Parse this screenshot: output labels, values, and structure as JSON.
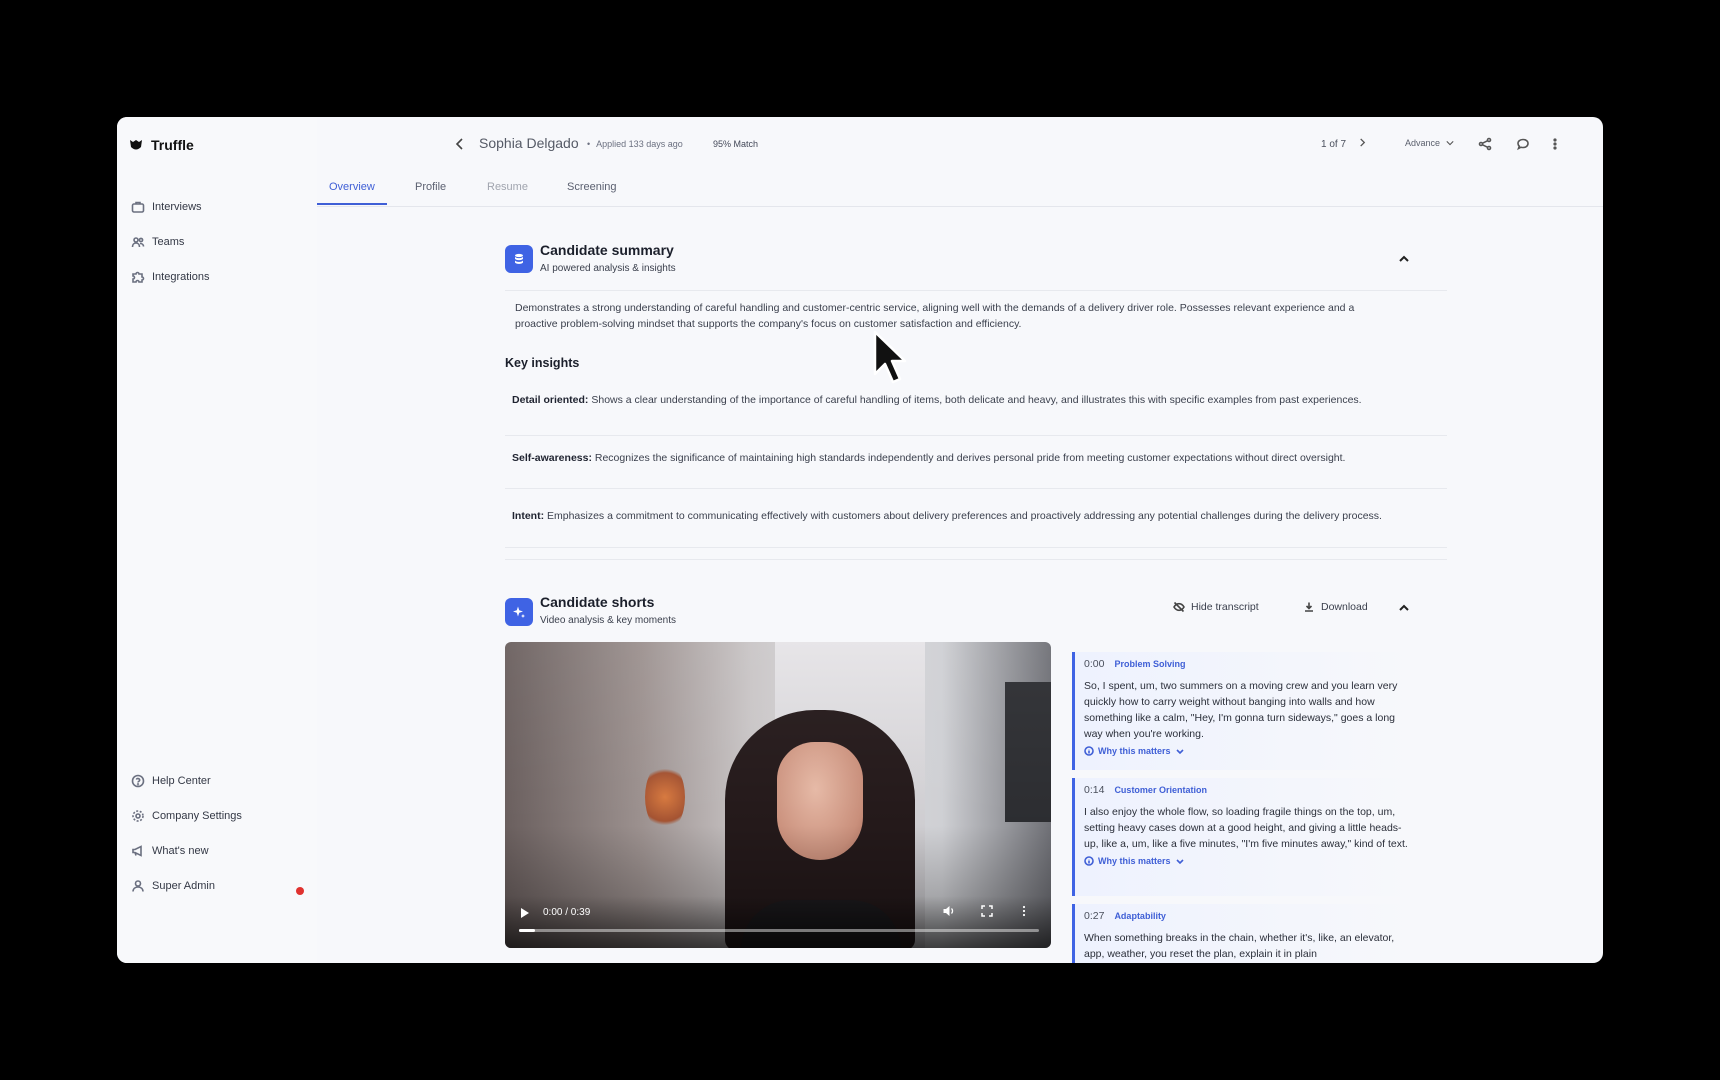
{
  "app": {
    "name": "Truffle"
  },
  "sidebar": {
    "top_items": [
      {
        "label": "Interviews",
        "icon": "briefcase-icon"
      },
      {
        "label": "Teams",
        "icon": "team-icon"
      },
      {
        "label": "Integrations",
        "icon": "puzzle-icon"
      }
    ],
    "bottom_items": [
      {
        "label": "Help Center",
        "icon": "help-circle-icon"
      },
      {
        "label": "Company Settings",
        "icon": "gear-icon"
      },
      {
        "label": "What's new",
        "icon": "megaphone-icon"
      },
      {
        "label": "Super Admin",
        "icon": "user-icon"
      }
    ]
  },
  "header": {
    "candidate_name": "Sophia Delgado",
    "applied": "Applied 133 days ago",
    "match": "95% Match",
    "pager": "1 of 7",
    "advance_label": "Advance"
  },
  "tabs": [
    {
      "label": "Overview"
    },
    {
      "label": "Profile"
    },
    {
      "label": "Resume"
    },
    {
      "label": "Screening"
    }
  ],
  "summary_section": {
    "title": "Candidate summary",
    "subtitle": "AI powered analysis & insights",
    "text": "Demonstrates a strong understanding of careful handling and customer-centric service, aligning well with the demands of a delivery driver role. Possesses relevant experience and a proactive problem-solving mindset that supports the company's focus on customer satisfaction and efficiency.",
    "key_insights_heading": "Key insights",
    "insights": [
      {
        "label": "Detail oriented:",
        "text": " Shows a clear understanding of the importance of careful handling of items, both delicate and heavy, and illustrates this with specific examples from past experiences."
      },
      {
        "label": "Self-awareness:",
        "text": " Recognizes the significance of maintaining high standards independently and derives personal pride from meeting customer expectations without direct oversight."
      },
      {
        "label": "Intent:",
        "text": " Emphasizes a commitment to communicating effectively with customers about delivery preferences and proactively addressing any potential challenges during the delivery process."
      }
    ]
  },
  "shorts_section": {
    "title": "Candidate shorts",
    "subtitle": "Video analysis & key moments",
    "hide_transcript_label": "Hide transcript",
    "download_label": "Download",
    "video": {
      "time": "0:00 / 0:39",
      "progress": 0.03
    },
    "transcript": [
      {
        "time": "0:00",
        "tag": "Problem Solving",
        "text": "So, I spent, um, two summers on a moving crew and you learn very quickly how to carry weight without banging into walls and how something like a calm, \"Hey, I'm gonna turn sideways,\" goes a long way when you're working.",
        "why": "Why this matters"
      },
      {
        "time": "0:14",
        "tag": "Customer Orientation",
        "text": "I also enjoy the whole flow, so loading fragile things on the top, um, setting heavy cases down at a good height, and giving a little heads-up, like a, um, like a five minutes, \"I'm five minutes away,\" kind of text.",
        "why": "Why this matters"
      },
      {
        "time": "0:27",
        "tag": "Adaptability",
        "text": "When something breaks in the chain, whether it's, like, an elevator, app, weather, you reset the plan, explain it in plain",
        "why": ""
      }
    ]
  },
  "colors": {
    "accent": "#3f63e4",
    "notification": "#e0322f"
  }
}
